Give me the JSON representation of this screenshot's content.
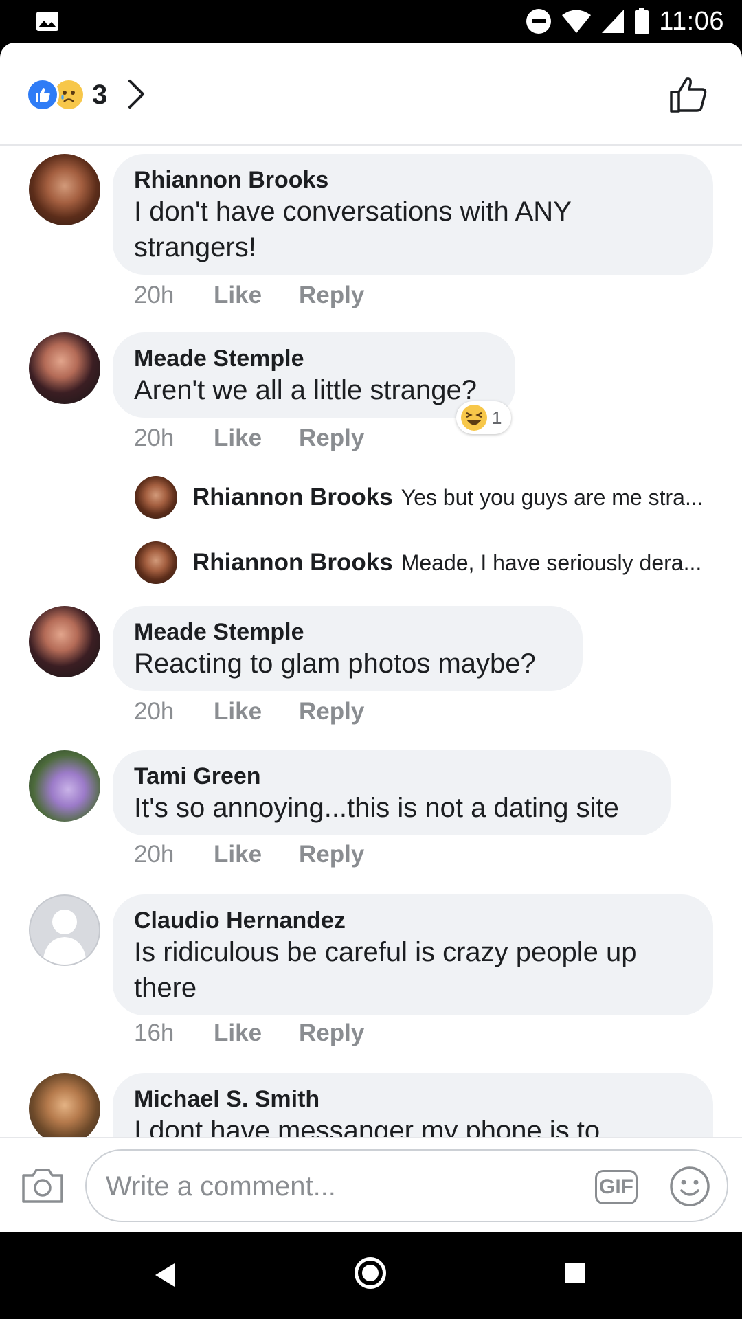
{
  "status_bar": {
    "time": "11:06",
    "icons": [
      "gallery-icon",
      "do-not-disturb-icon",
      "wifi-icon",
      "signal-icon",
      "battery-icon"
    ]
  },
  "reactions": {
    "count": "3",
    "icons": [
      "like-reaction-icon",
      "sad-reaction-icon"
    ]
  },
  "comments": [
    {
      "name": "Rhiannon Brooks",
      "text": "I don't have conversations with ANY strangers!",
      "time": "20h",
      "like": "Like",
      "reply": "Reply"
    },
    {
      "name": "Meade Stemple",
      "text": "Aren't we all a little strange?",
      "time": "20h",
      "like": "Like",
      "reply": "Reply",
      "reaction_count": "1",
      "replies": [
        {
          "name": "Rhiannon Brooks",
          "text": "Yes but you guys are me stra..."
        },
        {
          "name": "Rhiannon Brooks",
          "text": "Meade, I have seriously dera..."
        }
      ]
    },
    {
      "name": "Meade Stemple",
      "text": "Reacting to glam photos maybe?",
      "time": "20h",
      "like": "Like",
      "reply": "Reply"
    },
    {
      "name": "Tami Green",
      "text": "It's so annoying...this is not a dating site",
      "time": "20h",
      "like": "Like",
      "reply": "Reply"
    },
    {
      "name": "Claudio Hernandez",
      "text": "Is ridiculous be careful is crazy people  up there",
      "time": "16h",
      "like": "Like",
      "reply": "Reply"
    },
    {
      "name": "Michael S. Smith",
      "text": "I dont have messanger my phone is to"
    }
  ],
  "composer": {
    "placeholder": "Write a comment...",
    "gif_label": "GIF"
  },
  "colors": {
    "accent": "#2f7cf6",
    "bubble": "#f0f2f5",
    "meta": "#8a8d91"
  }
}
